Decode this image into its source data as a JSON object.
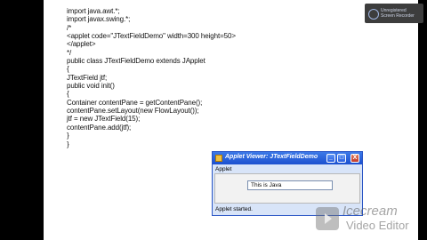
{
  "recorder": {
    "line1": "Unregistered",
    "line2": "Screen Recorder"
  },
  "code_lines": [
    "import java.awt.*;",
    "import javax.swing.*;",
    "/*",
    "<applet code=\"JTextFieldDemo\" width=300 height=50>",
    "</applet>",
    "*/",
    "public class JTextFieldDemo extends JApplet",
    "{",
    "JTextField jtf;",
    "public void init()",
    "{",
    "Container contentPane = getContentPane();",
    "contentPane.setLayout(new FlowLayout());",
    "jtf = new JTextField(15);",
    "contentPane.add(jtf);",
    "}",
    "}"
  ],
  "applet_window": {
    "title": "Applet Viewer: JTextFieldDemo",
    "menu_label": "Applet",
    "text_field_value": "This is Java",
    "status_text": "Applet started.",
    "buttons": {
      "minimize": "_",
      "maximize": "□",
      "close": "X"
    }
  },
  "watermark": {
    "line1": "Icecream",
    "line2": "Video Editor"
  }
}
